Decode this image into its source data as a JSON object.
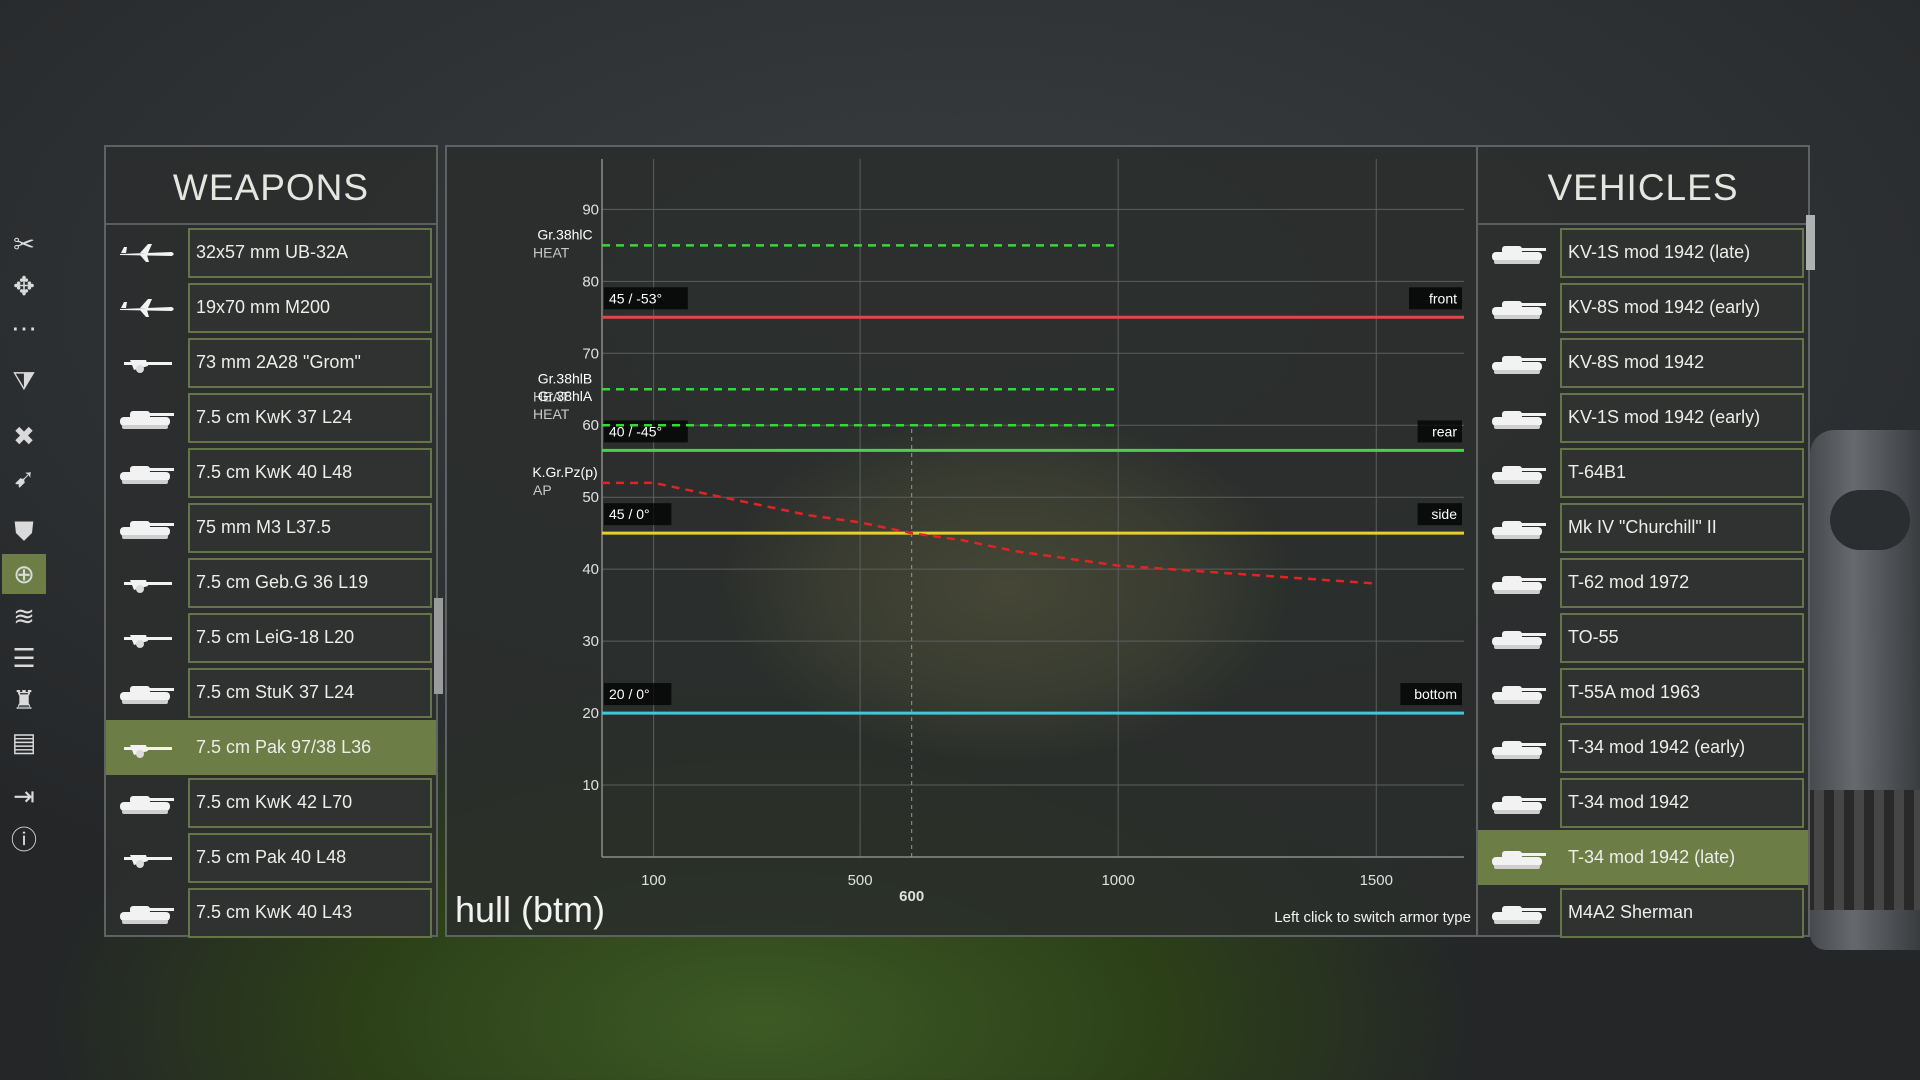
{
  "toolbar": {
    "items": [
      {
        "name": "scissors-icon",
        "glyph": "✂",
        "active": false
      },
      {
        "name": "move-icon",
        "glyph": "✥",
        "active": false
      },
      {
        "name": "dots-icon",
        "glyph": "⋯",
        "active": false
      },
      {
        "name": "filter-icon",
        "glyph": "⧩",
        "active": false
      },
      {
        "name": "close-icon",
        "glyph": "✖",
        "active": false
      },
      {
        "name": "gun-icon",
        "glyph": "➹",
        "active": false
      },
      {
        "name": "shield-icon",
        "glyph": "⛊",
        "active": false
      },
      {
        "name": "target-icon",
        "glyph": "⊕",
        "active": true
      },
      {
        "name": "terrain-icon",
        "glyph": "≋",
        "active": false
      },
      {
        "name": "list-icon",
        "glyph": "☰",
        "active": false
      },
      {
        "name": "soldier-icon",
        "glyph": "♜",
        "active": false
      },
      {
        "name": "book-icon",
        "glyph": "▤",
        "active": false
      },
      {
        "name": "exit-icon",
        "glyph": "⇥",
        "active": false
      },
      {
        "name": "info-icon",
        "glyph": "ⓘ",
        "active": false
      }
    ]
  },
  "weapons": {
    "title": "WEAPONS",
    "items": [
      {
        "label": "32x57 mm UB-32A",
        "icon": "aircraft-icon"
      },
      {
        "label": "19x70 mm M200",
        "icon": "aircraft-icon"
      },
      {
        "label": "73 mm 2A28 \"Grom\"",
        "icon": "gun-icon"
      },
      {
        "label": "7.5 cm KwK 37 L24",
        "icon": "tank-icon"
      },
      {
        "label": "7.5 cm KwK 40 L48",
        "icon": "tank-icon"
      },
      {
        "label": "75 mm M3 L37.5",
        "icon": "tank-icon"
      },
      {
        "label": "7.5 cm Geb.G 36 L19",
        "icon": "field-gun-icon"
      },
      {
        "label": "7.5 cm LeiG-18 L20",
        "icon": "field-gun-icon"
      },
      {
        "label": "7.5 cm StuK 37 L24",
        "icon": "tank-icon"
      },
      {
        "label": "7.5 cm Pak 97/38 L36",
        "icon": "gun-icon",
        "selected": true
      },
      {
        "label": "7.5 cm KwK 42 L70",
        "icon": "tank-icon"
      },
      {
        "label": "7.5 cm Pak 40 L48",
        "icon": "gun-icon"
      },
      {
        "label": "7.5 cm KwK 40 L43",
        "icon": "tank-icon"
      }
    ]
  },
  "vehicles": {
    "title": "VEHICLES",
    "items": [
      {
        "label": "KV-1S mod 1942 (late)"
      },
      {
        "label": "KV-8S mod 1942 (early)"
      },
      {
        "label": "KV-8S mod 1942"
      },
      {
        "label": "KV-1S mod 1942 (early)"
      },
      {
        "label": "T-64B1"
      },
      {
        "label": "Mk IV \"Churchill\" II"
      },
      {
        "label": "T-62 mod 1972"
      },
      {
        "label": "TO-55"
      },
      {
        "label": "T-55A mod 1963"
      },
      {
        "label": "T-34 mod 1942 (early)"
      },
      {
        "label": "T-34 mod 1942"
      },
      {
        "label": "T-34 mod 1942 (late)",
        "selected": true
      },
      {
        "label": "M4A2 Sherman"
      }
    ]
  },
  "chart": {
    "title": "hull (btm)",
    "hint": "Left click to switch armor type",
    "marker_label": "600"
  },
  "chart_data": {
    "type": "line",
    "xlabel": "",
    "ylabel": "",
    "xlim": [
      0,
      1670
    ],
    "ylim": [
      0,
      97
    ],
    "x_ticks": [
      100,
      500,
      1000,
      1500
    ],
    "y_ticks": [
      10,
      20,
      30,
      40,
      50,
      60,
      70,
      80,
      90
    ],
    "marker_x": 600,
    "grid": true,
    "armor_lines": [
      {
        "name": "front",
        "tag": "45 / -53°",
        "value": 75,
        "color": "#e04848"
      },
      {
        "name": "rear",
        "tag": "40 / -45°",
        "value": 56.5,
        "color": "#4ccf4c"
      },
      {
        "name": "side",
        "tag": "45 / 0°",
        "value": 45,
        "color": "#e8d02a"
      },
      {
        "name": "bottom",
        "tag": "20 / 0°",
        "value": 20,
        "color": "#40c8d8"
      }
    ],
    "ammo": [
      {
        "name": "Gr.38hlC",
        "type": "HEAT",
        "style": "flat",
        "value": 85,
        "x_end": 1000,
        "color": "#39d639"
      },
      {
        "name": "Gr.38hlB",
        "type": "HEAT",
        "style": "flat",
        "value": 65,
        "x_end": 1000,
        "color": "#39d639"
      },
      {
        "name": "Gr.38hlA",
        "type": "HEAT",
        "style": "flat",
        "value": 60,
        "x_end": 1000,
        "color": "#39d639"
      },
      {
        "name": "K.Gr.Pz(p)",
        "type": "AP",
        "style": "curve",
        "color": "#e02424",
        "x": [
          0,
          100,
          200,
          300,
          400,
          500,
          600,
          700,
          800,
          900,
          1000,
          1100,
          1200,
          1300,
          1400,
          1500
        ],
        "y": [
          52,
          52,
          50.5,
          49,
          47.5,
          46.5,
          45,
          44,
          42.5,
          41.5,
          40.5,
          40,
          39.5,
          39,
          38.5,
          38
        ]
      }
    ]
  }
}
